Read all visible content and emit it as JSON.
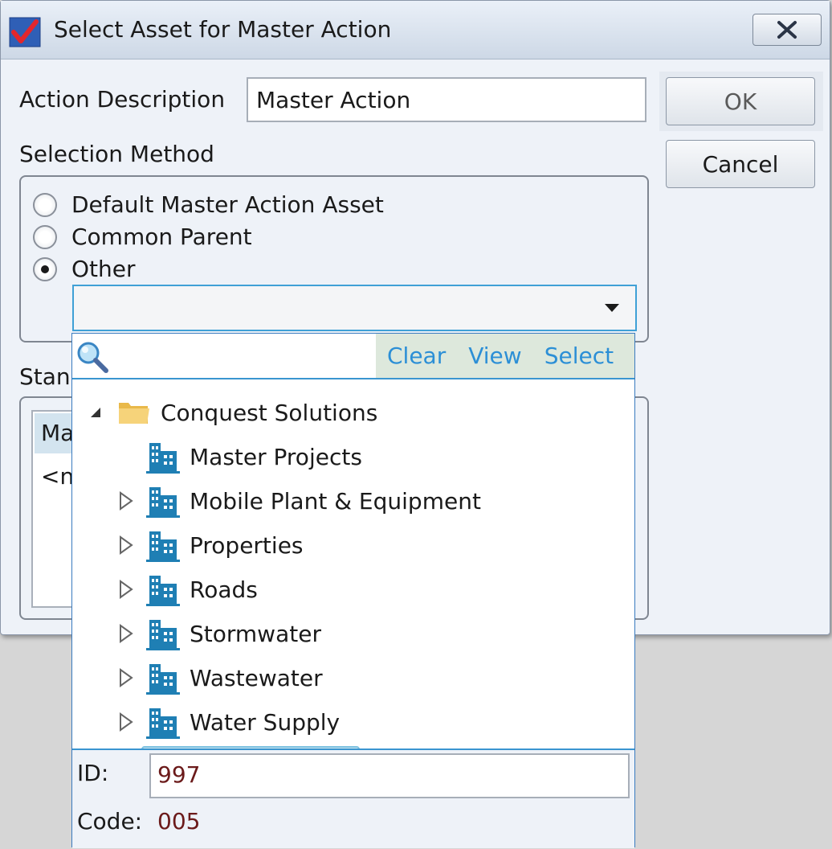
{
  "window": {
    "title": "Select Asset for Master Action",
    "close_label": "X"
  },
  "form": {
    "action_description_label": "Action Description",
    "action_description_value": "Master Action",
    "selection_method_label": "Selection Method",
    "radio_options": [
      {
        "label": "Default Master Action Asset",
        "selected": false
      },
      {
        "label": "Common Parent",
        "selected": false
      },
      {
        "label": "Other",
        "selected": true
      }
    ],
    "combo_value": "",
    "standard_label_partial": "Stan",
    "standard_header_partial": "Ma",
    "standard_row_partial": "<n"
  },
  "buttons": {
    "ok": "OK",
    "cancel": "Cancel"
  },
  "popup": {
    "search_placeholder": "",
    "actions": [
      "Clear",
      "View",
      "Select"
    ],
    "tree": {
      "root": "Conquest Solutions",
      "children": [
        {
          "label": "Master Projects",
          "expandable": false
        },
        {
          "label": "Mobile Plant & Equipment",
          "expandable": true
        },
        {
          "label": "Properties",
          "expandable": true
        },
        {
          "label": "Roads",
          "expandable": true
        },
        {
          "label": "Stormwater",
          "expandable": true
        },
        {
          "label": "Wastewater",
          "expandable": true
        },
        {
          "label": "Water Supply",
          "expandable": true,
          "selected": true
        }
      ]
    },
    "id_label": "ID:",
    "id_value": "997",
    "code_label": "Code:",
    "code_value": "005"
  },
  "colors": {
    "accent": "#3a95d0",
    "link": "#2c8fd6",
    "selected_bg": "#cde6f1",
    "value_text": "#6b1a1a",
    "icon_blue": "#1f7fb4"
  }
}
